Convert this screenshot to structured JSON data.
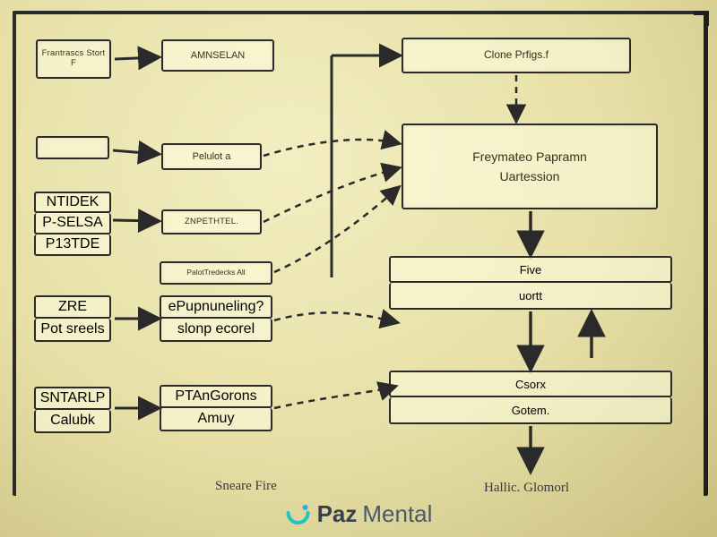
{
  "left_col": {
    "row1": {
      "label": "Frantrascs Stort F"
    },
    "row2": {
      "label": ""
    },
    "row3_a": {
      "label": "NTIDEK"
    },
    "row3_b": {
      "label": "P-SELSA"
    },
    "row3_c": {
      "label": "P13TDE"
    },
    "row4_a": {
      "label": "ZRE"
    },
    "row4_b": {
      "label": "Pot sreels"
    },
    "row5_a": {
      "label": "SNTARLP"
    },
    "row5_b": {
      "label": "Calubk"
    }
  },
  "mid_col": {
    "m1": {
      "label": "AMNSELAN"
    },
    "m2": {
      "label": "Pelulot a"
    },
    "m3": {
      "label": "ZNPETHTEL."
    },
    "m4": {
      "label": "PalotTredecks All"
    },
    "m5": {
      "label": "ePupnuneling?"
    },
    "m6": {
      "label": "slonp ecorel"
    },
    "m7a": {
      "label": "PTAnGorons"
    },
    "m7b": {
      "label": "Amuy"
    }
  },
  "right_col": {
    "r1": {
      "label": "Clone Prfigs.f"
    },
    "r2_line1": {
      "label": "Freymateo Papramn"
    },
    "r2_line2": {
      "label": "Uartession"
    },
    "r3a": {
      "label": "Five"
    },
    "r3b": {
      "label": "uortt"
    },
    "r4a": {
      "label": "Csorx"
    },
    "r4b": {
      "label": "Gotem."
    }
  },
  "captions": {
    "left": "Sneare Fire",
    "right": "Hallic. Glomorl"
  },
  "watermark": {
    "brand_p": "Paz",
    "brand_m": "Mental"
  },
  "colors": {
    "ink": "#2a2a2a",
    "paper": "#e6dfa5",
    "wm_teal": "#1fc6c0",
    "wm_blue": "#3aa8e6"
  }
}
